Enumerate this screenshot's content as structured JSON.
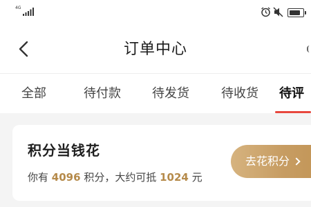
{
  "status_bar": {
    "network": "4G",
    "icons": [
      "signal-icon",
      "alarm-icon",
      "mute-icon",
      "battery-icon"
    ]
  },
  "header": {
    "title": "订单中心",
    "back_icon": "chevron-left-icon"
  },
  "tabs": [
    {
      "label": "全部"
    },
    {
      "label": "待付款"
    },
    {
      "label": "待发货"
    },
    {
      "label": "待收货"
    },
    {
      "label": "待评"
    }
  ],
  "active_tab": "待评",
  "points_card": {
    "title": "积分当钱花",
    "desc_prefix": "你有",
    "points": "4096",
    "desc_middle": "积分，大约可抵",
    "amount": "1024",
    "desc_suffix": "元",
    "button_label": "去花积分"
  },
  "colors": {
    "accent_red": "#e8473d",
    "gold": "#b58a4a",
    "button_gradient_start": "#d6b37f",
    "button_gradient_end": "#c39658"
  }
}
